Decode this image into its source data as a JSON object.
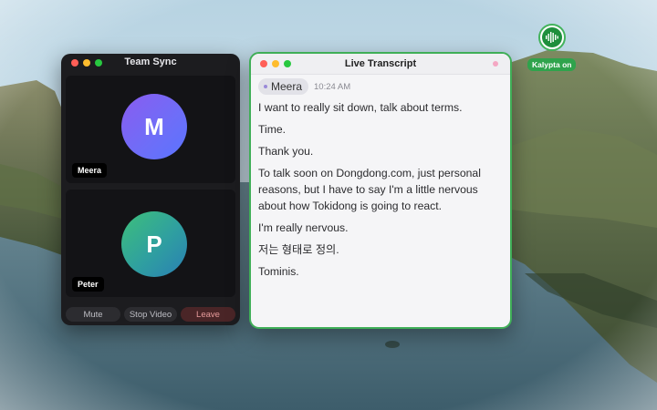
{
  "team_window": {
    "title": "Team Sync",
    "participants": [
      {
        "initial": "M",
        "name": "Meera"
      },
      {
        "initial": "P",
        "name": "Peter"
      }
    ],
    "controls": {
      "mute": "Mute",
      "stop_video": "Stop Video",
      "leave": "Leave"
    }
  },
  "transcript_window": {
    "title": "Live Transcript",
    "speaker": "Meera",
    "time": "10:24 AM",
    "lines": [
      "I want to really sit down, talk about terms.",
      "Time.",
      "Thank you.",
      "To talk soon on Dongdong.com, just personal reasons, but I have to say I'm a little nervous about how Tokidong is going to react.",
      "I'm really nervous.",
      "저는 형태로 정의.",
      "Tominis."
    ]
  },
  "kalypta": {
    "status": "Kalypta on",
    "icon": "waveform-icon"
  },
  "colors": {
    "accent_green": "#3fae57",
    "leave_red": "#e79b9b",
    "avatar_m": "#7a64f4",
    "avatar_p": "#35a98e"
  }
}
